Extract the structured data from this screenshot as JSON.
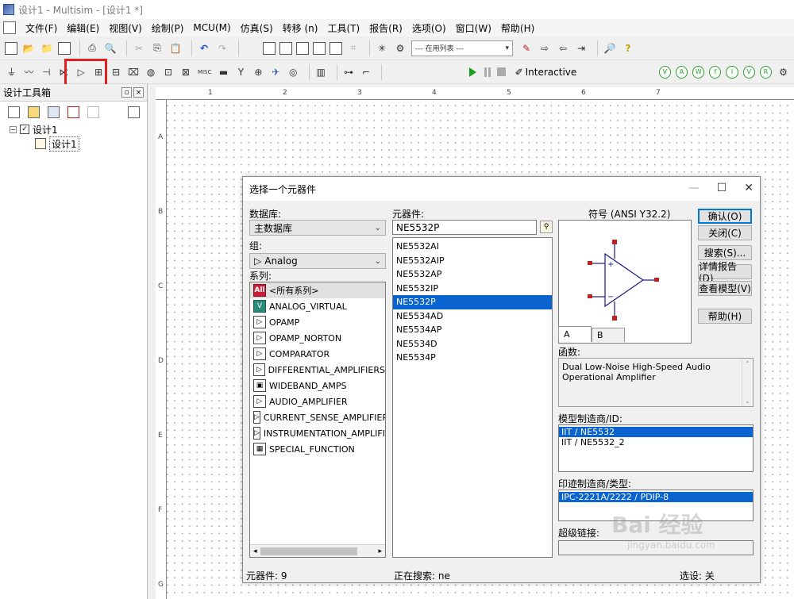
{
  "window": {
    "title": "设计1 - Multisim - [设计1 *]"
  },
  "menu": [
    "文件(F)",
    "编辑(E)",
    "视图(V)",
    "绘制(P)",
    "MCU(M)",
    "仿真(S)",
    "转移 (n)",
    "工具(T)",
    "报告(R)",
    "选项(O)",
    "窗口(W)",
    "帮助(H)"
  ],
  "toolbar1": {
    "in_use_list": "--- 在用列表 ---"
  },
  "toolbar2": {
    "misc_label": "MISC",
    "interactive_label": "Interactive"
  },
  "design_toolbox": {
    "title": "设计工具箱",
    "tree": {
      "root": "设计1",
      "child": "设计1"
    }
  },
  "ruler": {
    "top": [
      "1",
      "2",
      "3",
      "4",
      "5",
      "6",
      "7"
    ],
    "left": [
      "A",
      "B",
      "C",
      "D",
      "E",
      "F",
      "G"
    ]
  },
  "dialog": {
    "title": "选择一个元器件",
    "database_label": "数据库:",
    "database_value": "主数据库",
    "group_label": "组:",
    "group_value": "Analog",
    "family_label": "系列:",
    "families": [
      {
        "icon": "All",
        "name": "<所有系列>"
      },
      {
        "icon": "V",
        "name": "ANALOG_VIRTUAL"
      },
      {
        "icon": "▷",
        "name": "OPAMP"
      },
      {
        "icon": "▷",
        "name": "OPAMP_NORTON"
      },
      {
        "icon": "▷",
        "name": "COMPARATOR"
      },
      {
        "icon": "▷",
        "name": "DIFFERENTIAL_AMPLIFIERS"
      },
      {
        "icon": "▣",
        "name": "WIDEBAND_AMPS"
      },
      {
        "icon": "▷",
        "name": "AUDIO_AMPLIFIER"
      },
      {
        "icon": "▷",
        "name": "CURRENT_SENSE_AMPLIFIERS"
      },
      {
        "icon": "▷",
        "name": "INSTRUMENTATION_AMPLIFIE"
      },
      {
        "icon": "▦",
        "name": "SPECIAL_FUNCTION"
      }
    ],
    "component_label": "元器件:",
    "component_value": "NE5532P",
    "components": [
      "NE5532AI",
      "NE5532AIP",
      "NE5532AP",
      "NE5532IP",
      "NE5532P",
      "NE5534AD",
      "NE5534AP",
      "NE5534D",
      "NE5534P"
    ],
    "selected_component": "NE5532P",
    "symbol_label": "符号 (ANSI Y32.2)",
    "tabs": [
      "A",
      "B"
    ],
    "function_label": "函数:",
    "function_text": "Dual Low-Noise High-Speed Audio Operational Amplifier",
    "model_label": "模型制造商/ID:",
    "models": [
      "IIT / NE5532",
      "IIT / NE5532_2"
    ],
    "footprint_label": "印迹制造商/类型:",
    "footprints": [
      "IPC-2221A/2222 / PDIP-8"
    ],
    "hyperlink_label": "超级链接:",
    "buttons": {
      "ok": "确认(O)",
      "close": "关闭(C)",
      "search": "搜索(S)...",
      "detail": "详情报告(D)",
      "view_model": "查看模型(V)",
      "help": "帮助(H)"
    },
    "status": {
      "count": "元器件: 9",
      "searching": "正在搜索: ne",
      "selected": "选设: 关"
    }
  },
  "watermark": {
    "brand": "Bai 经验",
    "url": "jingyan.baidu.com"
  }
}
